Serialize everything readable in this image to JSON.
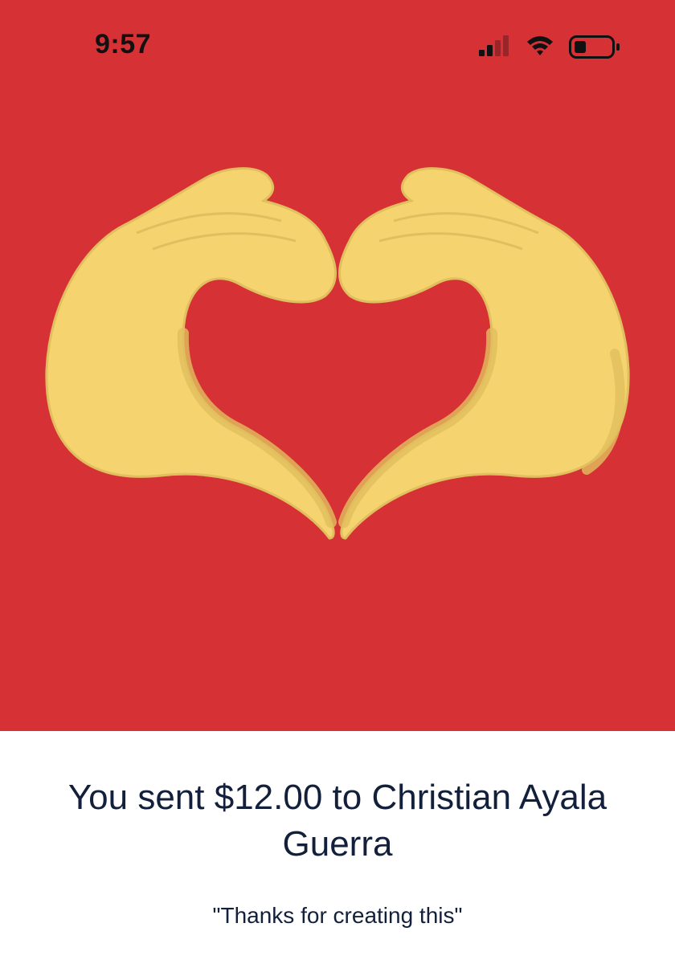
{
  "status_bar": {
    "time": "9:57",
    "signal_icon": "cellular-signal-icon",
    "wifi_icon": "wifi-icon",
    "battery_icon": "battery-low-icon"
  },
  "hero": {
    "background_color": "#d63134",
    "illustration": "heart-hands-icon",
    "hand_color": "#f5d36f"
  },
  "message": {
    "headline": "You sent $12.00 to Christian Ayala Guerra",
    "note": "\"Thanks for creating this\"",
    "text_color": "#13203b"
  }
}
